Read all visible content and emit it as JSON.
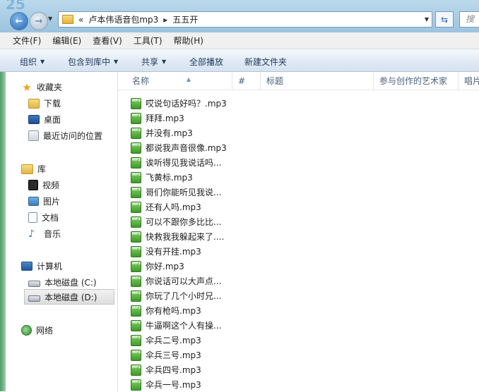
{
  "address_bar": {
    "overflow": "«",
    "segments": [
      "卢本伟语音包mp3",
      "五五开"
    ],
    "separator": "▸",
    "search_placeholder": "搜"
  },
  "menu": [
    "文件(F)",
    "编辑(E)",
    "查看(V)",
    "工具(T)",
    "帮助(H)"
  ],
  "commands": [
    "组织",
    "包含到库中",
    "共享",
    "全部播放",
    "新建文件夹"
  ],
  "nav": {
    "favorites": {
      "label": "收藏夹",
      "items": [
        "下载",
        "桌面",
        "最近访问的位置"
      ]
    },
    "libraries": {
      "label": "库",
      "items": [
        "视频",
        "图片",
        "文档",
        "音乐"
      ]
    },
    "computer": {
      "label": "计算机",
      "items": [
        "本地磁盘 (C:)",
        "本地磁盘 (D:)"
      ]
    },
    "network": {
      "label": "网络"
    }
  },
  "columns": [
    "名称",
    "#",
    "标题",
    "参与创作的艺术家",
    "唱片"
  ],
  "files": [
    "哎说句话好吗？.mp3",
    "拜拜.mp3",
    "并没有.mp3",
    "都说我声音很像.mp3",
    "诶听得见我说话吗...",
    "飞黄标.mp3",
    "哥们你能听见我说...",
    "还有人吗.mp3",
    "可以不跟你多比比...",
    "快救我我躲起来了....",
    "没有开挂.mp3",
    "你好.mp3",
    "你说话可以大声点...",
    "你玩了几个小时兄...",
    "你有枪吗.mp3",
    "牛逼啊这个人有操...",
    "伞兵二号.mp3",
    "伞兵三号.mp3",
    "伞兵四号.mp3",
    "伞兵一号.mp3"
  ],
  "file_icon_label": "MP3"
}
